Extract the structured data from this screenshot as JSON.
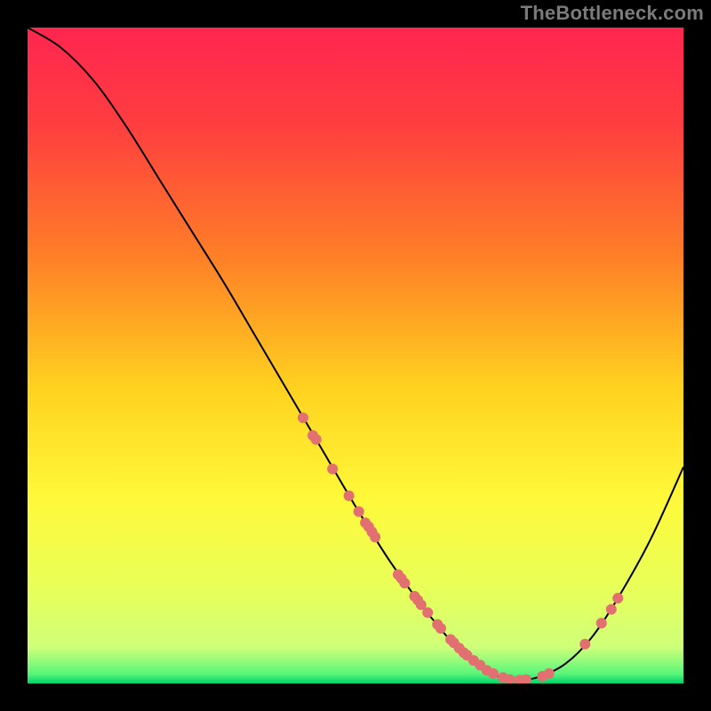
{
  "watermark": "TheBottleneck.com",
  "chart_data": {
    "type": "line",
    "title": "",
    "xlabel": "",
    "ylabel": "",
    "xlim": [
      0,
      100
    ],
    "ylim": [
      0,
      100
    ],
    "background_gradient": {
      "stops": [
        {
          "offset": 0.0,
          "color": "#ff2550"
        },
        {
          "offset": 0.15,
          "color": "#ff3e3f"
        },
        {
          "offset": 0.35,
          "color": "#ff7f27"
        },
        {
          "offset": 0.55,
          "color": "#ffd21f"
        },
        {
          "offset": 0.72,
          "color": "#fff93a"
        },
        {
          "offset": 0.86,
          "color": "#e7ff5a"
        },
        {
          "offset": 0.945,
          "color": "#cfff7a"
        },
        {
          "offset": 0.985,
          "color": "#5bf67a"
        },
        {
          "offset": 1.0,
          "color": "#00d26a"
        }
      ]
    },
    "curve": {
      "x": [
        0,
        5,
        10,
        15,
        20,
        25,
        30,
        35,
        40,
        45,
        50,
        55,
        60,
        62,
        65,
        68,
        70,
        72,
        75,
        78,
        82,
        86,
        90,
        95,
        100
      ],
      "y": [
        100,
        97,
        92,
        85,
        77,
        69,
        61,
        52.5,
        44,
        35.5,
        27,
        19,
        12,
        9.5,
        6,
        3.5,
        2,
        1,
        0.5,
        1,
        3,
        7,
        13,
        22,
        33
      ]
    },
    "points": {
      "color": "#e27070",
      "radius_px": 6,
      "xy": [
        [
          42.0,
          40.5
        ],
        [
          43.5,
          37.8
        ],
        [
          44.0,
          37.2
        ],
        [
          46.5,
          32.7
        ],
        [
          49.0,
          28.6
        ],
        [
          50.5,
          26.2
        ],
        [
          51.5,
          24.5
        ],
        [
          52.0,
          23.9
        ],
        [
          52.5,
          23.1
        ],
        [
          53.0,
          22.3
        ],
        [
          56.5,
          16.6
        ],
        [
          57.0,
          16.0
        ],
        [
          57.5,
          15.3
        ],
        [
          59.0,
          13.3
        ],
        [
          59.5,
          12.7
        ],
        [
          60.0,
          12.0
        ],
        [
          61.0,
          10.8
        ],
        [
          62.5,
          9.0
        ],
        [
          63.0,
          8.4
        ],
        [
          64.5,
          6.7
        ],
        [
          65.0,
          6.2
        ],
        [
          65.8,
          5.4
        ],
        [
          66.5,
          4.7
        ],
        [
          67.0,
          4.3
        ],
        [
          68.0,
          3.5
        ],
        [
          69.0,
          2.8
        ],
        [
          70.0,
          2.0
        ],
        [
          71.0,
          1.5
        ],
        [
          72.5,
          0.9
        ],
        [
          73.5,
          0.6
        ],
        [
          75.0,
          0.5
        ],
        [
          76.0,
          0.6
        ],
        [
          78.5,
          1.1
        ],
        [
          79.5,
          1.5
        ],
        [
          85.0,
          6.0
        ],
        [
          87.5,
          9.2
        ],
        [
          89.0,
          11.3
        ],
        [
          90.0,
          13.0
        ]
      ]
    }
  }
}
